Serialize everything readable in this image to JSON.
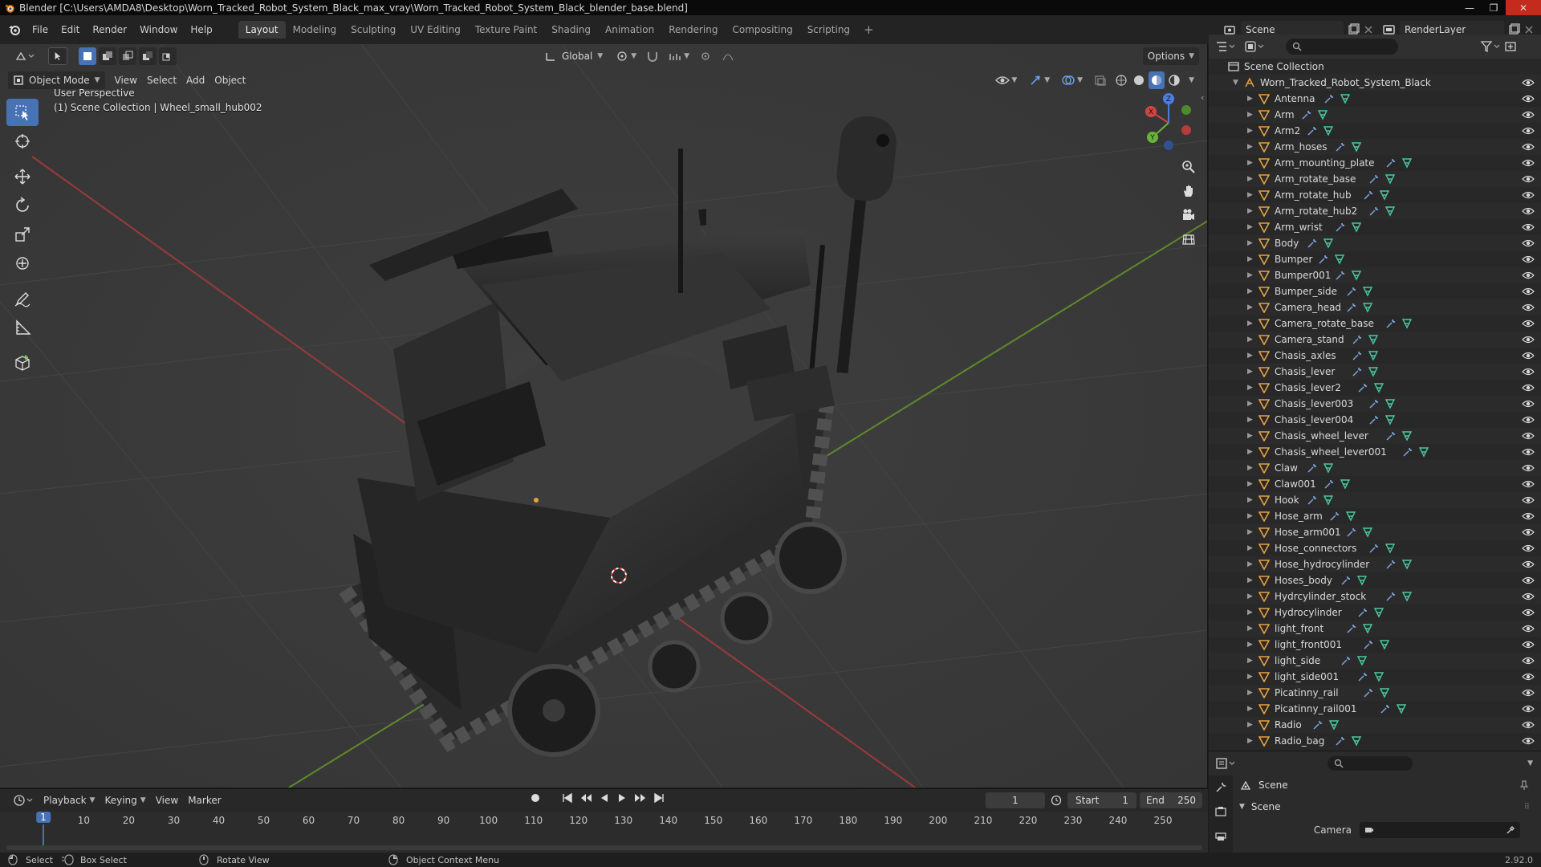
{
  "window": {
    "title": "Blender [C:\\Users\\AMDA8\\Desktop\\Worn_Tracked_Robot_System_Black_max_vray\\Worn_Tracked_Robot_System_Black_blender_base.blend]",
    "minimize": "—",
    "maximize": "❐",
    "close": "✕"
  },
  "menu": [
    "File",
    "Edit",
    "Render",
    "Window",
    "Help"
  ],
  "workspaces": [
    "Layout",
    "Modeling",
    "Sculpting",
    "UV Editing",
    "Texture Paint",
    "Shading",
    "Animation",
    "Rendering",
    "Compositing",
    "Scripting"
  ],
  "workspace_add": "+",
  "top_right": {
    "scene": "Scene",
    "view_layer": "RenderLayer"
  },
  "viewport": {
    "transform_orientation": "Global",
    "options_label": "Options",
    "mode": "Object Mode",
    "menus": [
      "View",
      "Select",
      "Add",
      "Object"
    ],
    "info_line1": "User Perspective",
    "info_line2": "(1) Scene Collection | Wheel_small_hub002",
    "gizmo": {
      "x": "X",
      "y": "Y",
      "z": "Z"
    }
  },
  "outliner": {
    "root": "Scene Collection",
    "collection": "Worn_Tracked_Robot_System_Black",
    "objects": [
      "Antenna",
      "Arm",
      "Arm2",
      "Arm_hoses",
      "Arm_mounting_plate",
      "Arm_rotate_base",
      "Arm_rotate_hub",
      "Arm_rotate_hub2",
      "Arm_wrist",
      "Body",
      "Bumper",
      "Bumper001",
      "Bumper_side",
      "Camera_head",
      "Camera_rotate_base",
      "Camera_stand",
      "Chasis_axles",
      "Chasis_lever",
      "Chasis_lever2",
      "Chasis_lever003",
      "Chasis_lever004",
      "Chasis_wheel_lever",
      "Chasis_wheel_lever001",
      "Claw",
      "Claw001",
      "Hook",
      "Hose_arm",
      "Hose_arm001",
      "Hose_connectors",
      "Hose_hydrocylinder",
      "Hoses_body",
      "Hydrcylinder_stock",
      "Hydrocylinder",
      "light_front",
      "light_front001",
      "light_side",
      "light_side001",
      "Picatinny_rail",
      "Picatinny_rail001",
      "Radio",
      "Radio_bag"
    ]
  },
  "properties": {
    "context": "Scene",
    "panel": "Scene",
    "camera_label": "Camera",
    "version": "2.92.0"
  },
  "timeline": {
    "menus": [
      "Playback",
      "Keying",
      "View",
      "Marker"
    ],
    "current_frame": "1",
    "start_label": "Start",
    "start": "1",
    "end_label": "End",
    "end": "250",
    "ruler": [
      "1",
      "10",
      "20",
      "30",
      "40",
      "50",
      "60",
      "70",
      "80",
      "90",
      "100",
      "110",
      "120",
      "130",
      "140",
      "150",
      "160",
      "170",
      "180",
      "190",
      "200",
      "210",
      "220",
      "230",
      "240",
      "250"
    ]
  },
  "statusbar": {
    "select": "Select",
    "box_select": "Box Select",
    "rotate_view": "Rotate View",
    "context_menu": "Object Context Menu"
  }
}
